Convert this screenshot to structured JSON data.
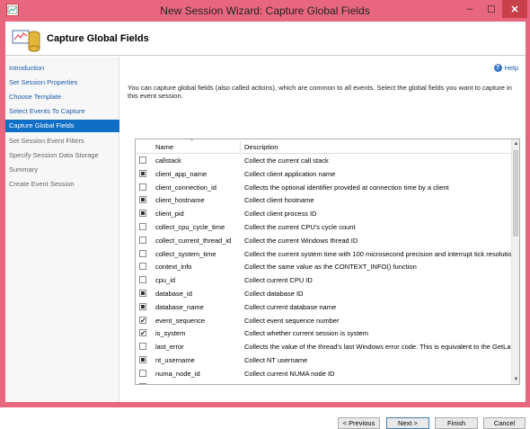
{
  "window": {
    "title": "New Session Wizard: Capture Global Fields",
    "app_icon": "wizard-app-icon",
    "controls": [
      "minimize-icon",
      "maximize-icon",
      "close-icon"
    ]
  },
  "header": {
    "title": "Capture Global Fields",
    "icon": "capture-fields-icon"
  },
  "sidebar": {
    "items": [
      {
        "label": "Introduction"
      },
      {
        "label": "Set Session Properties"
      },
      {
        "label": "Choose Template"
      },
      {
        "label": "Select Events To Capture"
      },
      {
        "label": "Capture Global Fields"
      },
      {
        "label": "Set Session Event Filters"
      },
      {
        "label": "Specify Session Data Storage"
      },
      {
        "label": "Summary"
      },
      {
        "label": "Create Event Session"
      }
    ]
  },
  "help": {
    "label": "Help",
    "icon": "help-icon"
  },
  "description": "You can capture global fields (also called actions), which are common to all events. Select the global fields you want to capture in this event session.",
  "table": {
    "columns": [
      "Name",
      "Description"
    ],
    "sort_icon": "sort-ascending-icon",
    "rows": [
      {
        "name": "callstack",
        "desc": "Collect the current call stack",
        "checked": "empty"
      },
      {
        "name": "client_app_name",
        "desc": "Collect client application name",
        "checked": "filled"
      },
      {
        "name": "client_connection_id",
        "desc": "Collects the optional identifier provided at connection time by a client",
        "checked": "empty"
      },
      {
        "name": "client_hostname",
        "desc": "Collect client hostname",
        "checked": "filled"
      },
      {
        "name": "client_pid",
        "desc": "Collect client process ID",
        "checked": "filled"
      },
      {
        "name": "collect_cpu_cycle_time",
        "desc": "Collect the current CPU's cycle count",
        "checked": "empty"
      },
      {
        "name": "collect_current_thread_id",
        "desc": "Collect the current Windows thread ID",
        "checked": "empty"
      },
      {
        "name": "collect_system_time",
        "desc": "Collect the current system time with 100 microsecond precision and interrupt tick resolution",
        "checked": "empty"
      },
      {
        "name": "context_info",
        "desc": "Collect the same value as the CONTEXT_INFO() function",
        "checked": "empty"
      },
      {
        "name": "cpu_id",
        "desc": "Collect current CPU ID",
        "checked": "empty"
      },
      {
        "name": "database_id",
        "desc": "Collect database ID",
        "checked": "filled"
      },
      {
        "name": "database_name",
        "desc": "Collect current database name",
        "checked": "filled"
      },
      {
        "name": "event_sequence",
        "desc": "Collect event sequence number",
        "checked": "check"
      },
      {
        "name": "is_system",
        "desc": "Collect whether current session is system",
        "checked": "check"
      },
      {
        "name": "last_error",
        "desc": "Collects the value of the thread's last Windows error code. This is equivalent to the GetLastE...",
        "checked": "empty"
      },
      {
        "name": "nt_username",
        "desc": "Collect NT username",
        "checked": "filled"
      },
      {
        "name": "numa_node_id",
        "desc": "Collect current NUMA node ID",
        "checked": "empty"
      },
      {
        "name": "plan_handle",
        "desc": "Collect plan handle",
        "checked": "empty"
      }
    ]
  },
  "buttons": {
    "previous": "< Previous",
    "next": "Next >",
    "finish": "Finish",
    "cancel": "Cancel"
  }
}
